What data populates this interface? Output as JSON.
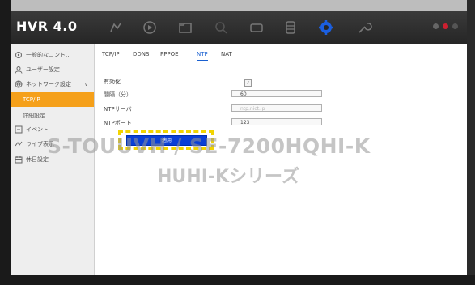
{
  "brand": {
    "logo": "HVR 4.0"
  },
  "topbar": {
    "icons": [
      "playback-icon",
      "record-icon",
      "folder-icon",
      "search-icon",
      "display-icon",
      "storage-icon",
      "settings-icon",
      "tools-icon"
    ],
    "active_icon": "settings-icon",
    "accent_color": "#1b5fe0"
  },
  "sidebar": {
    "items": [
      {
        "label": "一般的なコント...",
        "icon": "gear-icon"
      },
      {
        "label": "ユーザー設定",
        "icon": "user-icon"
      },
      {
        "label": "ネットワーク設定",
        "icon": "globe-icon"
      },
      {
        "label": "TCP/IP",
        "icon": ""
      },
      {
        "label": "詳細設定",
        "icon": ""
      },
      {
        "label": "イベント",
        "icon": "event-icon"
      },
      {
        "label": "ライブ表示",
        "icon": "camera-icon"
      },
      {
        "label": "休日設定",
        "icon": "calendar-icon"
      }
    ],
    "active_color": "#f5a01a"
  },
  "tabs": [
    "TCP/IP",
    "DDNS",
    "PPPOE",
    "NTP",
    "NAT"
  ],
  "active_tab": "NTP",
  "form": {
    "enable_label": "有効化",
    "interval_label": "間隔（分）",
    "interval_value": "60",
    "server_label": "NTPサーバ",
    "server_value": "ntp.nict.jp",
    "port_label": "NTPポート",
    "port_value": "123",
    "apply_label": "適用"
  },
  "highlight_color": "#f2d400",
  "watermark": {
    "line1": "S-TOUUVH / SE-7200HQHI-K",
    "line2": "HUHI-Kシリーズ"
  }
}
